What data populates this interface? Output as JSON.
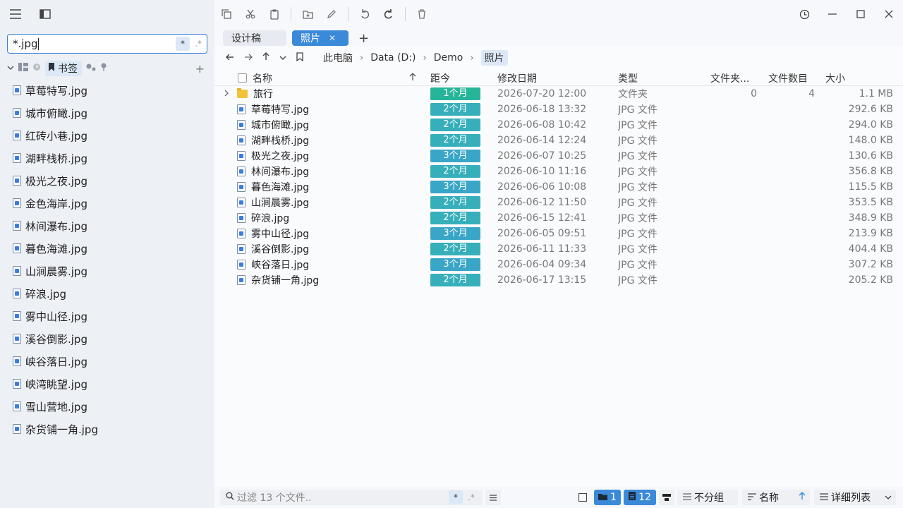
{
  "sidebar": {
    "search_value": "*.jpg",
    "search_chip_wildcard": "*",
    "search_chip_regex": ".*",
    "active_tab_label": "书签",
    "add_label": "+",
    "items": [
      {
        "label": "草莓特写.jpg"
      },
      {
        "label": "城市俯瞰.jpg"
      },
      {
        "label": "红砖小巷.jpg"
      },
      {
        "label": "湖畔栈桥.jpg"
      },
      {
        "label": "极光之夜.jpg"
      },
      {
        "label": "金色海岸.jpg"
      },
      {
        "label": "林间瀑布.jpg"
      },
      {
        "label": "暮色海滩.jpg"
      },
      {
        "label": "山涧晨雾.jpg"
      },
      {
        "label": "碎浪.jpg"
      },
      {
        "label": "雾中山径.jpg"
      },
      {
        "label": "溪谷倒影.jpg"
      },
      {
        "label": "峡谷落日.jpg"
      },
      {
        "label": "峡湾眺望.jpg"
      },
      {
        "label": "雪山营地.jpg"
      },
      {
        "label": "杂货铺一角.jpg"
      }
    ]
  },
  "tabs": [
    {
      "label": "设计稿",
      "active": false
    },
    {
      "label": "照片",
      "active": true,
      "close": "✕"
    }
  ],
  "tab_add": "+",
  "breadcrumb": [
    "此电脑",
    "Data (D:)",
    "Demo",
    "照片"
  ],
  "columns": {
    "name": "名称",
    "age": "距今",
    "date": "修改日期",
    "type": "类型",
    "folder_count": "文件夹...",
    "file_count": "文件数目",
    "size": "大小"
  },
  "rows": [
    {
      "name": "旅行",
      "kind": "folder",
      "age": "1个月",
      "age_color": "#27b59a",
      "date": "2026-07-20 12:00",
      "type": "文件夹",
      "folder_count": "0",
      "file_count": "4",
      "size": "1.1 MB"
    },
    {
      "name": "草莓特写.jpg",
      "kind": "file",
      "age": "2个月",
      "age_color": "#36afbb",
      "date": "2026-06-18 13:32",
      "type": "JPG 文件",
      "folder_count": "",
      "file_count": "",
      "size": "292.6 KB"
    },
    {
      "name": "城市俯瞰.jpg",
      "kind": "file",
      "age": "2个月",
      "age_color": "#36afbb",
      "date": "2026-06-08 10:42",
      "type": "JPG 文件",
      "folder_count": "",
      "file_count": "",
      "size": "294.0 KB"
    },
    {
      "name": "湖畔栈桥.jpg",
      "kind": "file",
      "age": "2个月",
      "age_color": "#36afbb",
      "date": "2026-06-14 12:24",
      "type": "JPG 文件",
      "folder_count": "",
      "file_count": "",
      "size": "148.0 KB"
    },
    {
      "name": "极光之夜.jpg",
      "kind": "file",
      "age": "3个月",
      "age_color": "#3aa6c7",
      "date": "2026-06-07 10:25",
      "type": "JPG 文件",
      "folder_count": "",
      "file_count": "",
      "size": "130.6 KB"
    },
    {
      "name": "林间瀑布.jpg",
      "kind": "file",
      "age": "2个月",
      "age_color": "#36afbb",
      "date": "2026-06-10 11:16",
      "type": "JPG 文件",
      "folder_count": "",
      "file_count": "",
      "size": "356.8 KB"
    },
    {
      "name": "暮色海滩.jpg",
      "kind": "file",
      "age": "3个月",
      "age_color": "#3aa6c7",
      "date": "2026-06-06 10:08",
      "type": "JPG 文件",
      "folder_count": "",
      "file_count": "",
      "size": "115.5 KB"
    },
    {
      "name": "山涧晨雾.jpg",
      "kind": "file",
      "age": "2个月",
      "age_color": "#36afbb",
      "date": "2026-06-12 11:50",
      "type": "JPG 文件",
      "folder_count": "",
      "file_count": "",
      "size": "353.5 KB"
    },
    {
      "name": "碎浪.jpg",
      "kind": "file",
      "age": "2个月",
      "age_color": "#36afbb",
      "date": "2026-06-15 12:41",
      "type": "JPG 文件",
      "folder_count": "",
      "file_count": "",
      "size": "348.9 KB"
    },
    {
      "name": "雾中山径.jpg",
      "kind": "file",
      "age": "3个月",
      "age_color": "#3aa6c7",
      "date": "2026-06-05 09:51",
      "type": "JPG 文件",
      "folder_count": "",
      "file_count": "",
      "size": "213.9 KB"
    },
    {
      "name": "溪谷倒影.jpg",
      "kind": "file",
      "age": "2个月",
      "age_color": "#36afbb",
      "date": "2026-06-11 11:33",
      "type": "JPG 文件",
      "folder_count": "",
      "file_count": "",
      "size": "404.4 KB"
    },
    {
      "name": "峡谷落日.jpg",
      "kind": "file",
      "age": "3个月",
      "age_color": "#3aa6c7",
      "date": "2026-06-04 09:34",
      "type": "JPG 文件",
      "folder_count": "",
      "file_count": "",
      "size": "307.2 KB"
    },
    {
      "name": "杂货铺一角.jpg",
      "kind": "file",
      "age": "2个月",
      "age_color": "#36afbb",
      "date": "2026-06-17 13:15",
      "type": "JPG 文件",
      "folder_count": "",
      "file_count": "",
      "size": "205.2 KB"
    }
  ],
  "statusbar": {
    "filter_placeholder": "过滤 13 个文件..",
    "filter_chip_wildcard": "*",
    "filter_chip_regex": ".*",
    "folder_count": "1",
    "file_count": "12",
    "group_label": "不分组",
    "sort_label": "名称",
    "view_label": "详细列表"
  },
  "colors": {
    "accent": "#3b8ad9"
  }
}
